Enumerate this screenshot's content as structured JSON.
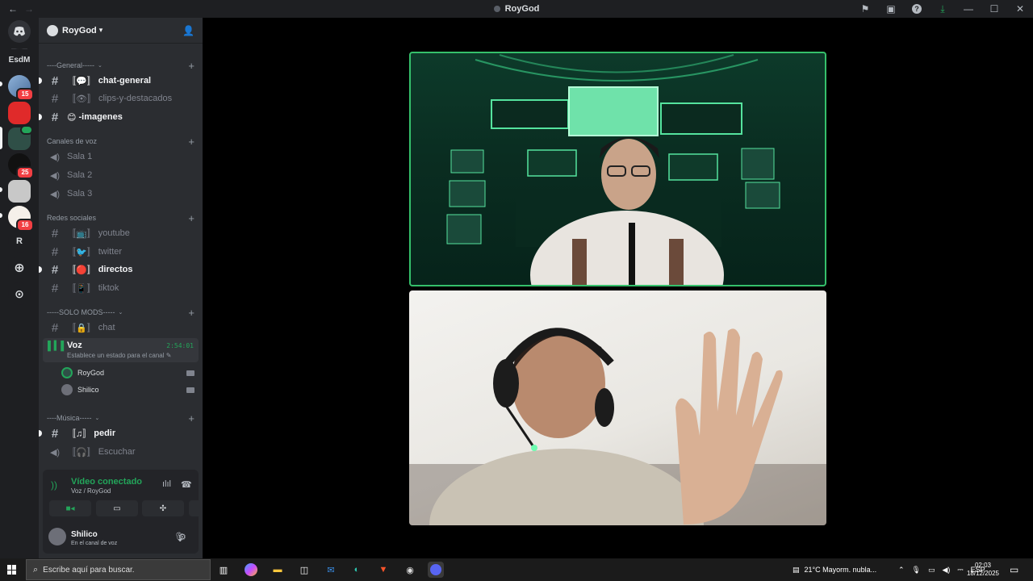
{
  "window": {
    "title": "RoyGod"
  },
  "server": {
    "name": "RoyGod"
  },
  "rail": {
    "servers": [
      "EsdM",
      "R"
    ],
    "badges": [
      "15",
      "25",
      "16"
    ]
  },
  "categories": [
    "----General-----",
    "Canales de voz",
    "Redes sociales",
    "-----SOLO MODS-----",
    "----Música-----"
  ],
  "channels": {
    "chat_general": "chat-general",
    "clips": "clips-y-destacados",
    "imagenes": "-imagenes",
    "sala1": "Sala 1",
    "sala2": "Sala 2",
    "sala3": "Sala 3",
    "youtube": "youtube",
    "twitter": "twitter",
    "directos": "directos",
    "tiktok": "tiktok",
    "chat": "chat",
    "voz": "Voz",
    "pedir": "pedir",
    "escuchar": "Escuchar"
  },
  "voice_channel": {
    "timer": "2:54:01",
    "status_prompt": "Establece un estado para el canal",
    "users": [
      "RoyGod",
      "Shilico"
    ]
  },
  "voice_panel": {
    "title": "Vídeo conectado",
    "subtitle": "Voz / RoyGod"
  },
  "user": {
    "name": "Shilico",
    "status": "En el canal de voz"
  },
  "taskbar": {
    "search_placeholder": "Escribe aquí para buscar.",
    "weather": "21°C  Mayorm. nubla...",
    "lang": "ESP",
    "time": "02:03",
    "date": "18/12/2025"
  },
  "colors": {
    "accent_green": "#23a55a",
    "tile_border": "#35c06b",
    "badge_red": "#f23f43"
  }
}
